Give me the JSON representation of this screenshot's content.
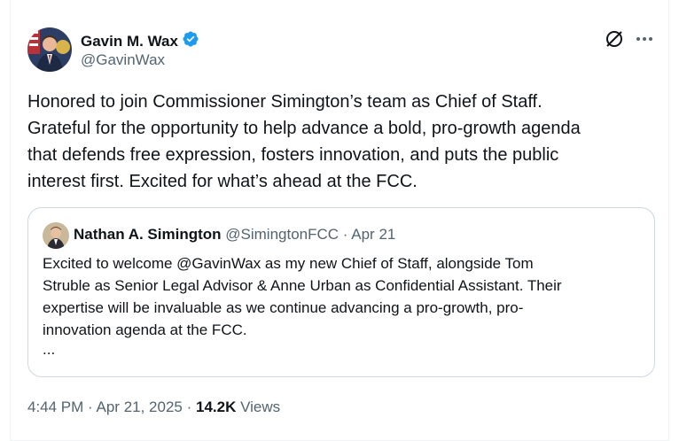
{
  "author": {
    "display_name": "Gavin M. Wax",
    "handle": "@GavinWax",
    "verified": true
  },
  "tweet": {
    "text": "Honored to join Commissioner Simington’s team as Chief of Staff.\nGrateful for the opportunity to help advance a bold, pro-growth agenda\nthat defends free expression, fosters innovation, and puts the public\ninterest first. Excited for what’s ahead at the FCC."
  },
  "quote": {
    "display_name": "Nathan A. Simington",
    "handle": "@SimingtonFCC",
    "separator": "·",
    "date": "Apr 21",
    "text": "Excited to welcome @GavinWax as my new Chief of Staff, alongside Tom\nStruble as Senior Legal Advisor & Anne Urban as Confidential Assistant. Their\nexpertise will be invaluable as we continue advancing a pro-growth, pro-\ninnovation agenda at the FCC.",
    "ellipsis": "..."
  },
  "meta": {
    "time": "4:44 PM",
    "separator": "·",
    "date": "Apr 21, 2025",
    "views_count": "14.2K",
    "views_label": "Views"
  },
  "icons": {
    "verified": "verified-badge-icon",
    "grok": "grok-icon",
    "more": "more-icon"
  },
  "colors": {
    "verified": "#1d9bf0",
    "secondary_text": "#536471",
    "primary_text": "#0f1419",
    "border": "#cfd9de"
  }
}
